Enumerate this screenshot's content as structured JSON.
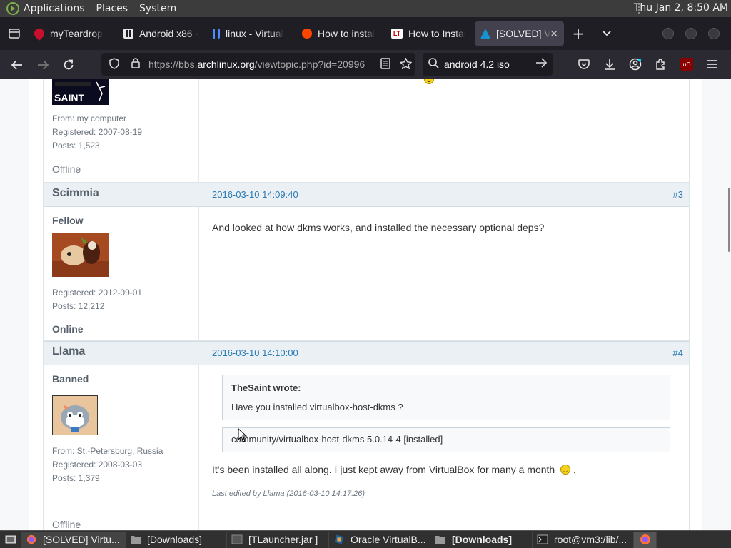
{
  "panel": {
    "menus": [
      "Applications",
      "Places",
      "System"
    ],
    "clock": "Thu Jan  2,  8:50 AM"
  },
  "tabs": [
    {
      "title": "myTeardrop",
      "favicon": "teardrop-favicon",
      "color": "#c8102e"
    },
    {
      "title": "Android x86 - ",
      "favicon": "archive-favicon",
      "color": "#e8e8e8"
    },
    {
      "title": "linux - Virtual",
      "favicon": "bracket-favicon",
      "color": "#4c8dff"
    },
    {
      "title": "How to instal",
      "favicon": "reddit-favicon",
      "color": "#ff4500"
    },
    {
      "title": "How to Instal",
      "favicon": "lt-favicon",
      "color": "#ffffff"
    },
    {
      "title": "[SOLVED] V",
      "favicon": "arch-favicon",
      "color": "#1793d1",
      "active": true
    }
  ],
  "navbar": {
    "url_prefix": "https://bbs.",
    "url_domain": "archlinux.org",
    "url_suffix": "/viewtopic.php?id=20996",
    "search_value": "android 4.2 iso"
  },
  "posts": [
    {
      "tail_lines": [
        "From: my computer",
        "Registered: 2007-08-19",
        "Posts: 1,523"
      ],
      "status": "Offline"
    },
    {
      "author": "Scimmia",
      "date": "2016-03-10 14:09:40",
      "num": "#3",
      "title": "Fellow",
      "stats": [
        "Registered: 2012-09-01",
        "Posts: 12,212"
      ],
      "status": "Online",
      "body": "And looked at how dkms works, and installed the necessary optional deps?"
    },
    {
      "author": "Llama",
      "date": "2016-03-10 14:10:00",
      "num": "#4",
      "title": "Banned",
      "stats": [
        "From: St.-Petersburg, Russia",
        "Registered: 2008-03-03",
        "Posts: 1,379"
      ],
      "status": "Offline",
      "quote_author": "TheSaint wrote:",
      "quote_text": "Have you installed virtualbox-host-dkms ?",
      "code": "community/virtualbox-host-dkms 5.0.14-4 [installed]",
      "body": "It's been installed all along. I just kept away from VirtualBox for many a month",
      "body_end": ".",
      "edited": "Last edited by Llama (2016-03-10 14:17:26)"
    }
  ],
  "taskbar": [
    {
      "label": "[SOLVED] Virtu...",
      "icon": "firefox-icon",
      "active": true
    },
    {
      "label": "[Downloads]",
      "icon": "folder-icon"
    },
    {
      "label": "[TLauncher.jar ]",
      "icon": "java-icon"
    },
    {
      "label": "Oracle VirtualB...",
      "icon": "virtualbox-icon"
    },
    {
      "label": "[Downloads]",
      "icon": "folder-icon",
      "bold": true
    },
    {
      "label": "root@vm3:/lib/...",
      "icon": "terminal-icon"
    }
  ]
}
